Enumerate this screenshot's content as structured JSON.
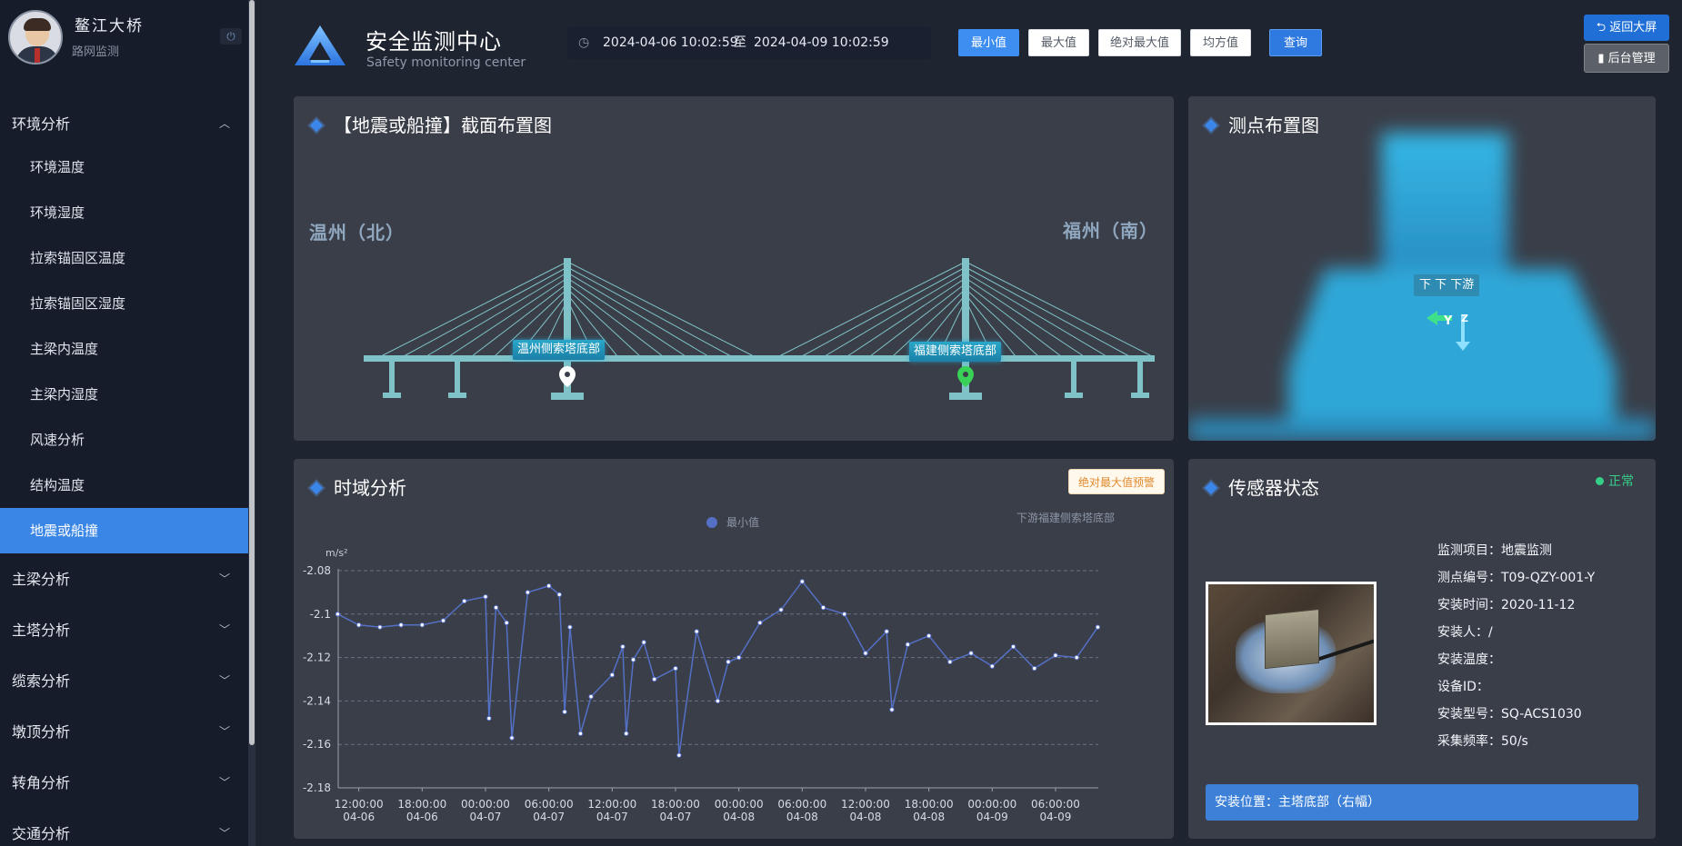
{
  "sidebar": {
    "profile": {
      "name": "鳌江大桥",
      "subtitle": "路网监测",
      "power_icon": "power-icon"
    },
    "groups": [
      {
        "label": "环境分析",
        "expanded": true,
        "items": [
          "环境温度",
          "环境湿度",
          "拉索锚固区温度",
          "拉索锚固区湿度",
          "主梁内温度",
          "主梁内湿度",
          "风速分析",
          "结构温度",
          "地震或船撞"
        ],
        "active_item": "地震或船撞"
      },
      {
        "label": "主梁分析",
        "expanded": false
      },
      {
        "label": "主塔分析",
        "expanded": false
      },
      {
        "label": "缆索分析",
        "expanded": false
      },
      {
        "label": "墩顶分析",
        "expanded": false
      },
      {
        "label": "转角分析",
        "expanded": false
      },
      {
        "label": "交通分析",
        "expanded": false
      }
    ]
  },
  "header": {
    "title": "安全监测中心",
    "subtitle": "Safety monitoring center",
    "date_start": "2024-04-06 10:02:59",
    "date_sep": "至",
    "date_end": "2024-04-09 10:02:59",
    "buttons": [
      "最小值",
      "最大值",
      "绝对最大值",
      "均方值"
    ],
    "active_button": "最小值",
    "query_label": "查询",
    "back_label": "返回大屏",
    "admin_label": "后台管理"
  },
  "section_panel": {
    "title": "【地震或船撞】截面布置图",
    "city_left": "温州（北）",
    "city_right": "福州（南）",
    "tag_left": "温州侧索塔底部",
    "tag_right": "福建侧索塔底部"
  },
  "layout_panel": {
    "title": "测点布置图",
    "label": "下 下 下游",
    "axis_y": "Y",
    "axis_z": "Z"
  },
  "time_panel": {
    "title": "时域分析",
    "warn_label": "绝对最大值预警",
    "legend_label": "最小值",
    "sub_label": "下游福建侧索塔底部"
  },
  "sensor_panel": {
    "title": "传感器状态",
    "status": "正常",
    "status_color": "#36cf8a",
    "info": [
      {
        "label": "监测项目：",
        "value": "地震监测"
      },
      {
        "label": "测点编号：",
        "value": "T09-QZY-001-Y"
      },
      {
        "label": "安装时间：",
        "value": "2020-11-12"
      },
      {
        "label": "安装人：",
        "value": "/"
      },
      {
        "label": "安装温度：",
        "value": ""
      },
      {
        "label": "设备ID：",
        "value": ""
      },
      {
        "label": "安装型号：",
        "value": "SQ-ACS1030"
      },
      {
        "label": "采集频率：",
        "value": "50/s"
      }
    ],
    "location": "安装位置：主塔底部（右幅）"
  },
  "chart_data": {
    "type": "line",
    "ylabel": "m/s²",
    "ylim": [
      -2.18,
      -2.08
    ],
    "yticks": [
      -2.08,
      -2.1,
      -2.12,
      -2.14,
      -2.16,
      -2.18
    ],
    "xticks": [
      [
        "12:00:00",
        "04-06"
      ],
      [
        "18:00:00",
        "04-06"
      ],
      [
        "00:00:00",
        "04-07"
      ],
      [
        "06:00:00",
        "04-07"
      ],
      [
        "12:00:00",
        "04-07"
      ],
      [
        "18:00:00",
        "04-07"
      ],
      [
        "00:00:00",
        "04-08"
      ],
      [
        "06:00:00",
        "04-08"
      ],
      [
        "12:00:00",
        "04-08"
      ],
      [
        "18:00:00",
        "04-08"
      ],
      [
        "00:00:00",
        "04-09"
      ],
      [
        "06:00:00",
        "04-09"
      ]
    ],
    "x_start": "2024-04-06 10:02:59",
    "x_end": "2024-04-09 10:02:59",
    "grid": true,
    "series": [
      {
        "name": "最小值",
        "color": "#5470c6",
        "x": [
          "2024-04-06 10:00",
          "2024-04-06 12:00",
          "2024-04-06 14:00",
          "2024-04-06 16:00",
          "2024-04-06 18:00",
          "2024-04-06 20:00",
          "2024-04-06 22:00",
          "2024-04-07 00:00",
          "2024-04-07 00:20",
          "2024-04-07 01:00",
          "2024-04-07 02:00",
          "2024-04-07 02:30",
          "2024-04-07 04:00",
          "2024-04-07 06:00",
          "2024-04-07 07:00",
          "2024-04-07 07:30",
          "2024-04-07 08:00",
          "2024-04-07 09:00",
          "2024-04-07 10:00",
          "2024-04-07 12:00",
          "2024-04-07 13:00",
          "2024-04-07 13:20",
          "2024-04-07 14:00",
          "2024-04-07 15:00",
          "2024-04-07 16:00",
          "2024-04-07 18:00",
          "2024-04-07 18:20",
          "2024-04-07 20:00",
          "2024-04-07 22:00",
          "2024-04-07 23:00",
          "2024-04-08 00:00",
          "2024-04-08 02:00",
          "2024-04-08 04:00",
          "2024-04-08 06:00",
          "2024-04-08 08:00",
          "2024-04-08 10:00",
          "2024-04-08 12:00",
          "2024-04-08 14:00",
          "2024-04-08 14:30",
          "2024-04-08 16:00",
          "2024-04-08 18:00",
          "2024-04-08 20:00",
          "2024-04-08 22:00",
          "2024-04-09 00:00",
          "2024-04-09 02:00",
          "2024-04-09 04:00",
          "2024-04-09 06:00",
          "2024-04-09 08:00",
          "2024-04-09 10:00"
        ],
        "y": [
          -2.1,
          -2.105,
          -2.106,
          -2.105,
          -2.105,
          -2.103,
          -2.094,
          -2.092,
          -2.148,
          -2.097,
          -2.104,
          -2.157,
          -2.09,
          -2.087,
          -2.091,
          -2.145,
          -2.106,
          -2.155,
          -2.138,
          -2.128,
          -2.115,
          -2.155,
          -2.121,
          -2.113,
          -2.13,
          -2.125,
          -2.165,
          -2.108,
          -2.14,
          -2.122,
          -2.12,
          -2.104,
          -2.098,
          -2.085,
          -2.097,
          -2.1,
          -2.118,
          -2.108,
          -2.144,
          -2.114,
          -2.11,
          -2.122,
          -2.118,
          -2.124,
          -2.115,
          -2.125,
          -2.119,
          -2.12,
          -2.106
        ]
      }
    ]
  }
}
